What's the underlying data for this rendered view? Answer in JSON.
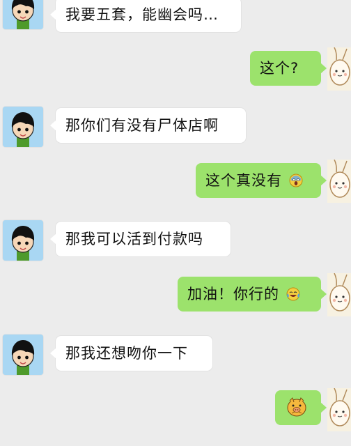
{
  "messages": [
    {
      "side": "left",
      "sender": "other",
      "text": "我要五套，能幽会吗…",
      "avatar": "cartoon-boy"
    },
    {
      "side": "right",
      "sender": "self",
      "text": "这个?",
      "avatar": "cartoon-bunny"
    },
    {
      "side": "left",
      "sender": "other",
      "text": "那你们有没有尸体店啊",
      "avatar": "cartoon-boy"
    },
    {
      "side": "right",
      "sender": "self",
      "text": "这个真没有",
      "emoji": "scream-emoji",
      "avatar": "cartoon-bunny"
    },
    {
      "side": "left",
      "sender": "other",
      "text": "那我可以活到付款吗",
      "avatar": "cartoon-boy"
    },
    {
      "side": "right",
      "sender": "self",
      "text": "加油！你行的",
      "emoji": "tears-of-joy-emoji",
      "avatar": "cartoon-bunny"
    },
    {
      "side": "left",
      "sender": "other",
      "text": "那我还想吻你一下",
      "avatar": "cartoon-boy"
    },
    {
      "side": "right",
      "sender": "self",
      "text": "",
      "sticker": "pig-sticker",
      "avatar": "cartoon-bunny"
    }
  ],
  "colors": {
    "background": "#ececec",
    "incoming_bubble": "#ffffff",
    "outgoing_bubble": "#9ce26c",
    "text": "#111111"
  }
}
